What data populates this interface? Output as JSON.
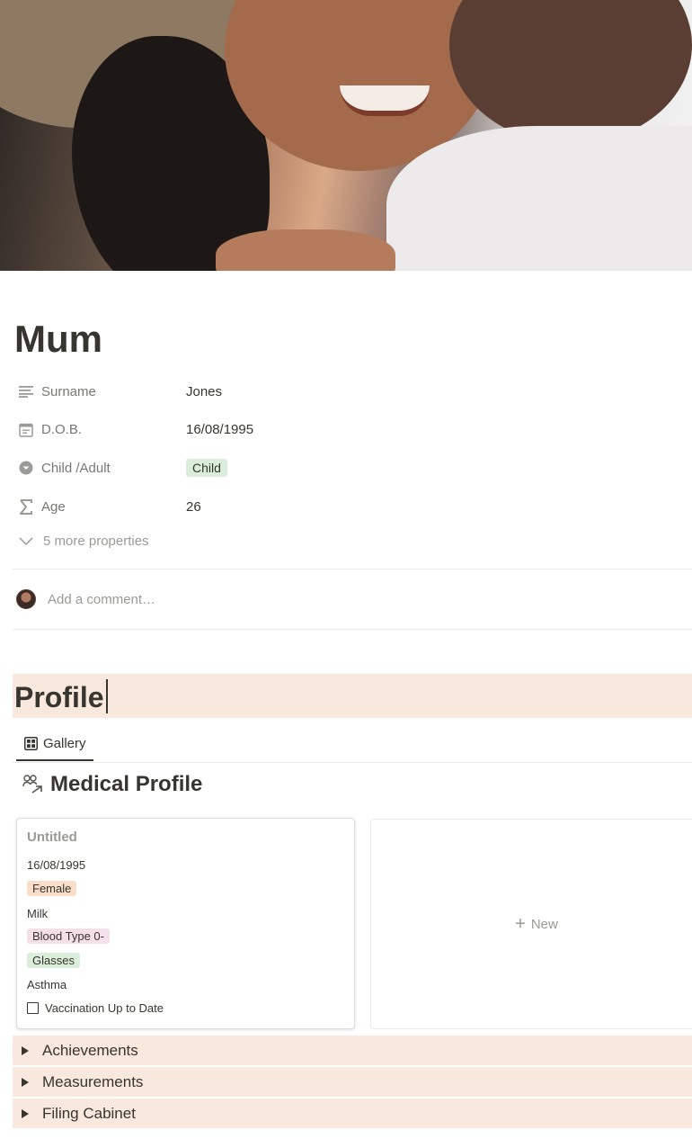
{
  "page": {
    "title": "Mum"
  },
  "properties": [
    {
      "label": "Surname",
      "icon": "text-lines-icon",
      "value": "Jones"
    },
    {
      "label": "D.O.B.",
      "icon": "calendar-icon",
      "value": "16/08/1995"
    },
    {
      "label": "Child /Adult",
      "icon": "select-icon",
      "value": "Child"
    },
    {
      "label": "Age",
      "icon": "formula-sigma-icon",
      "value": "26"
    }
  ],
  "more_properties": "5 more properties",
  "comment": {
    "placeholder": "Add a comment…"
  },
  "heading": {
    "text": "Profile"
  },
  "view": {
    "tab_label": "Gallery"
  },
  "database": {
    "title": "Medical Profile",
    "card": {
      "title": "Untitled",
      "dob": "16/08/1995",
      "gender": "Female",
      "allergy": "Milk",
      "blood_type": "Blood Type 0-",
      "vision": "Glasses",
      "condition": "Asthma",
      "vaccination_label": "Vaccination Up to Date",
      "vaccination_checked": false
    },
    "new_label": "New"
  },
  "toggles": [
    {
      "label": "Achievements"
    },
    {
      "label": "Measurements"
    },
    {
      "label": "Filing Cabinet"
    }
  ],
  "colors": {
    "heading_background": "#f8e8dd",
    "tag_green": "#dbeddb",
    "tag_orange": "#fadec9",
    "tag_pink": "#f5e0e9",
    "text": "#37352f",
    "muted": "#9b9a97"
  }
}
